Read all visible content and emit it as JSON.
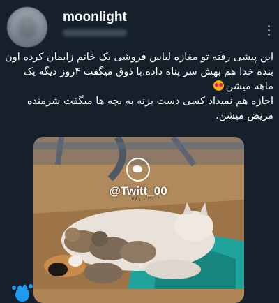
{
  "user": {
    "name": "moonlight"
  },
  "tweet": {
    "lines": [
      "این پیشی رفته تو مغازه لباس فروشی یک خانم زایمان کرده اون",
      "بنده خدا هم بهش سر پناه داده.با ذوق میگفت ۴روز دیگه یک",
      "ماهه میشن",
      "اجازه هم نمیداد کسی دست بزنه به بچه ها میگفت شرمنده",
      "مریض میشن."
    ],
    "emoji": "smiling-face-with-heart-eyes"
  },
  "media": {
    "watermark": "@Twitt_00",
    "description_icons": [
      "twitter-bird-icon"
    ]
  },
  "colors": {
    "background": "#15202b",
    "text": "#ffffff",
    "secondary": "#8b98a5"
  }
}
